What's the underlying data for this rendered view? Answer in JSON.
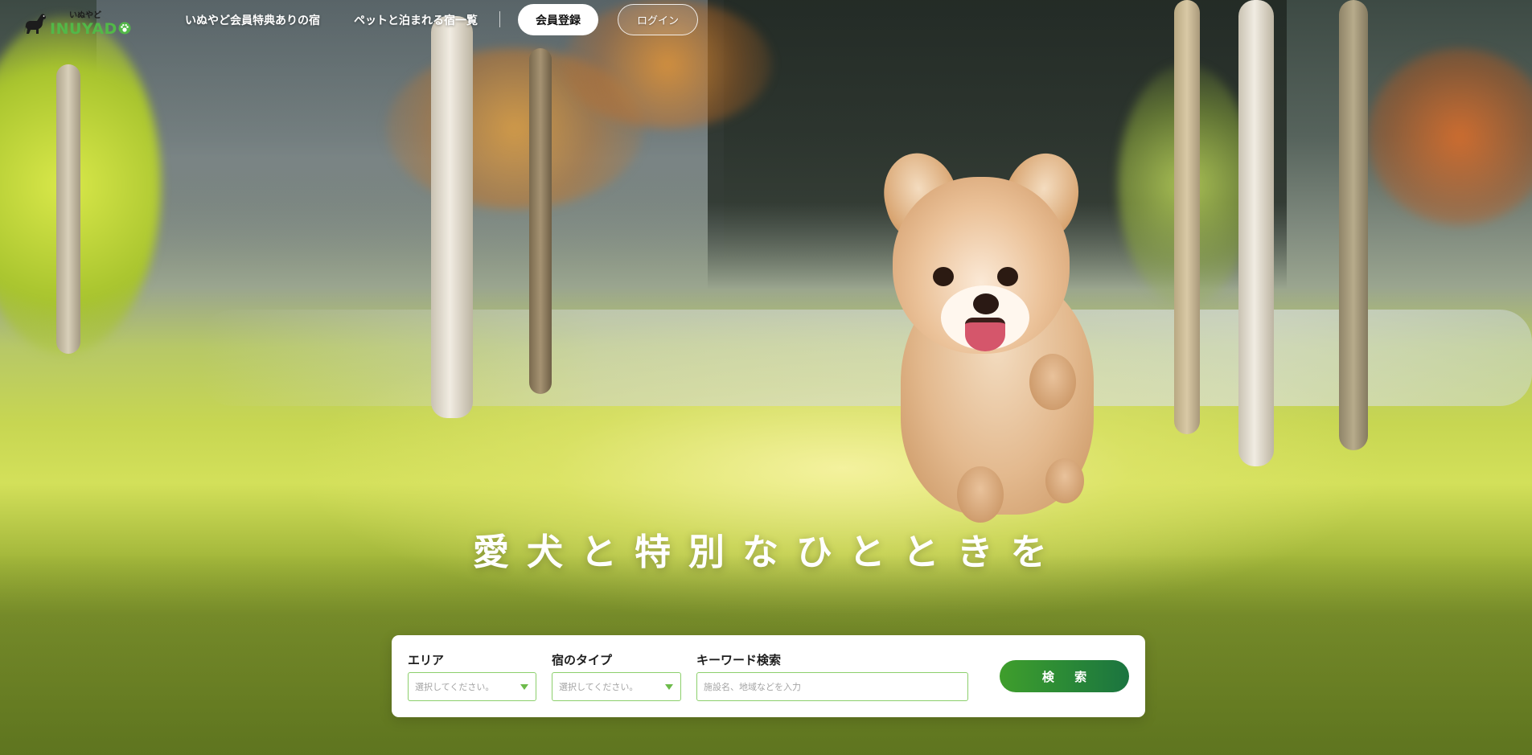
{
  "header": {
    "logo": {
      "kana": "いぬやど",
      "word": "INUYAD",
      "paw_icon": "paw-icon",
      "dog_icon": "dog-silhouette-icon"
    },
    "nav": [
      {
        "label": "いぬやど会員特典ありの宿"
      },
      {
        "label": "ペットと泊まれる宿一覧"
      }
    ],
    "register_label": "会員登録",
    "login_label": "ログイン"
  },
  "hero": {
    "catchphrase": "愛犬と特別なひとときを"
  },
  "search": {
    "area": {
      "label": "エリア",
      "value": "選択してください。"
    },
    "type": {
      "label": "宿のタイプ",
      "value": "選択してください。"
    },
    "keyword": {
      "label": "キーワード検索",
      "placeholder": "施設名、地域などを入力"
    },
    "submit_label": "検 索"
  },
  "colors": {
    "brand_green": "#52b848",
    "field_border": "#8ccf6c",
    "search_button_start": "#3f9e2c",
    "search_button_end": "#1b7440"
  }
}
